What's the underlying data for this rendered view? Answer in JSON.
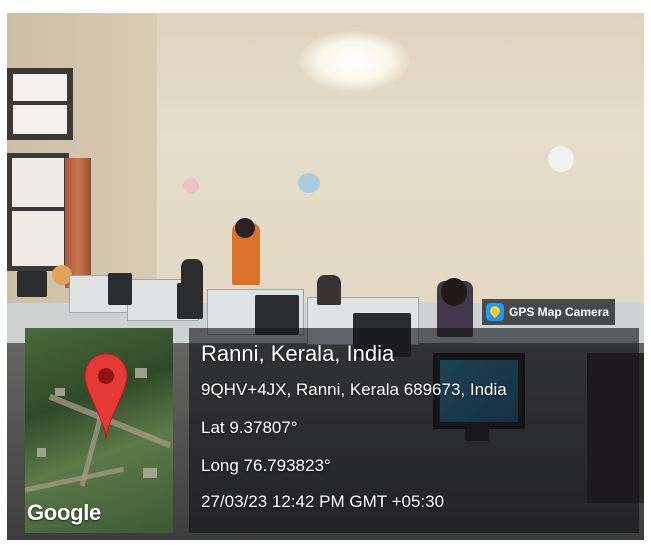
{
  "overlay": {
    "title": "Ranni, Kerala, India",
    "address": "9QHV+4JX, Ranni, Kerala 689673, India",
    "latitude": "Lat 9.37807°",
    "longitude": "Long 76.793823°",
    "timestamp": "27/03/23 12:42 PM GMT +05:30"
  },
  "badge": {
    "label": "GPS Map Camera",
    "icon": "map-pin-app-icon"
  },
  "map": {
    "logo_text": "Google",
    "marker_icon": "map-marker-icon",
    "marker_color": "#e53935"
  }
}
